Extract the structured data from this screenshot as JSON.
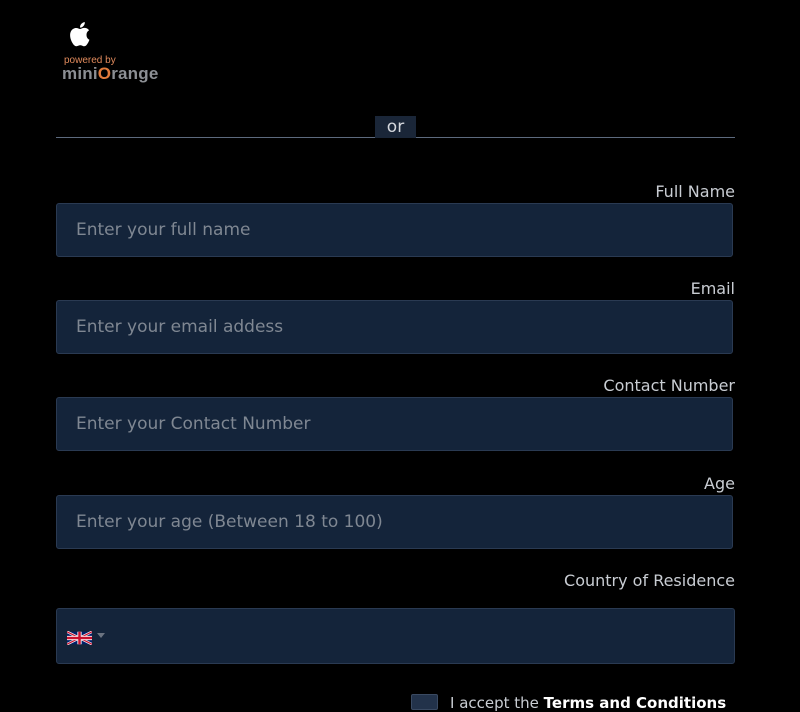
{
  "brand": {
    "powered_by": "powered by",
    "name_pre": "mini",
    "name_o": "O",
    "name_post": "range",
    "icon": "apple-icon",
    "accent_color": "#e07a3c"
  },
  "separator": {
    "or_label": "or"
  },
  "form": {
    "full_name": {
      "label": "Full Name",
      "placeholder": "Enter your full name"
    },
    "email": {
      "label": "Email",
      "placeholder": "Enter your email addess"
    },
    "contact": {
      "label": "Contact Number",
      "placeholder": "Enter your Contact Number"
    },
    "age": {
      "label": "Age",
      "placeholder": "Enter your age (Between 18 to 100)"
    },
    "country": {
      "label": "Country of Residence",
      "flag_icon": "uk-flag-icon"
    }
  },
  "terms": {
    "text": "I accept the ",
    "link": "Terms and Conditions"
  },
  "colors": {
    "background": "#000000",
    "field_bg": "#14243a",
    "label": "#c9cdd3"
  }
}
